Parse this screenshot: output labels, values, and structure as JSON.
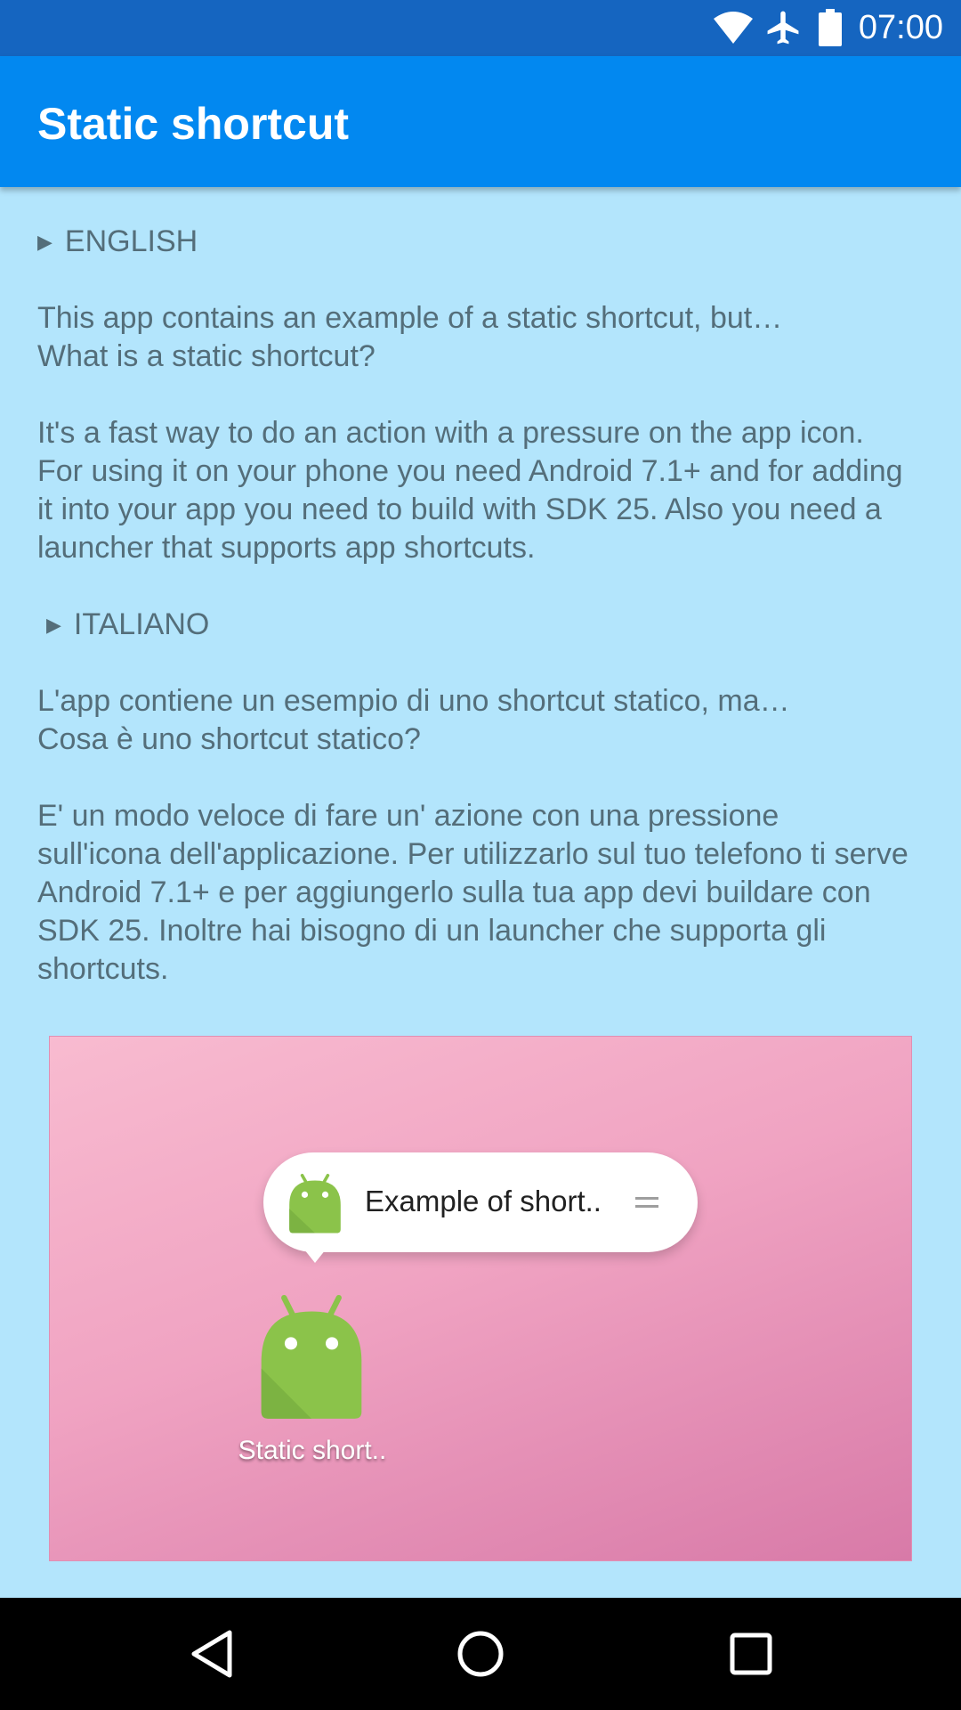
{
  "status_bar": {
    "time": "07:00",
    "icons": [
      "wifi-icon",
      "airplane-icon",
      "battery-icon"
    ]
  },
  "app_bar": {
    "title": "Static shortcut",
    "color": "#0288F0"
  },
  "content": {
    "english_header": "ENGLISH",
    "english_p1_line1": "This app contains an example of a static shortcut, but…",
    "english_p1_line2": "What is a static shortcut?",
    "english_p2": "It's a fast way to do an action with a pressure on the app icon. For using it on your phone you need Android 7.1+ and for adding it into your app you need to build with SDK 25. Also you need a launcher that supports app shortcuts.",
    "italian_header": "ITALIANO",
    "italian_p1_line1": "L'app contiene un esempio di uno shortcut statico, ma…",
    "italian_p1_line2": "Cosa è uno shortcut statico?",
    "italian_p2": "E' un modo veloce di fare un' azione con una pressione sull'icona dell'applicazione. Per utilizzarlo sul tuo telefono ti serve Android 7.1+ e per aggiungerlo sulla tua app devi buildare con SDK 25. Inoltre hai bisogno di un launcher che supporta gli shortcuts."
  },
  "illustration": {
    "shortcut_label": "Example of short..",
    "app_label": "Static short.."
  },
  "nav_bar": {
    "icons": [
      "back-icon",
      "home-icon",
      "recents-icon"
    ]
  }
}
